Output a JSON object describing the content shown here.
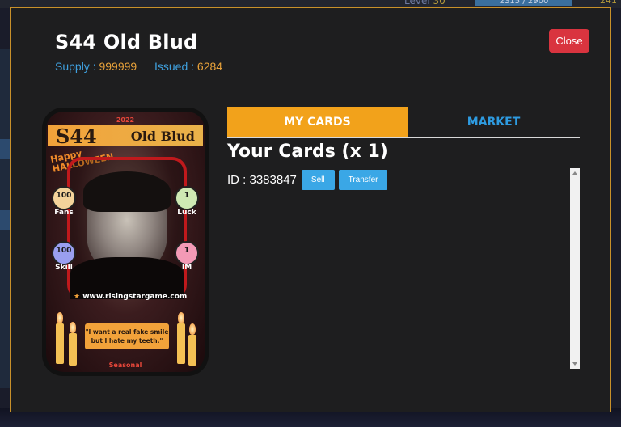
{
  "background": {
    "level_label": "Level",
    "level_value": "30",
    "xp_text": "2315 / 2900",
    "top_right_value": "241"
  },
  "modal": {
    "title": "S44 Old Blud",
    "supply_label": "Supply :",
    "supply_value": "999999",
    "issued_label": "Issued :",
    "issued_value": "6284",
    "close_label": "Close"
  },
  "card": {
    "year": "2022",
    "code": "S44",
    "name": "Old Blud",
    "halloween_line1": "Happy",
    "halloween_line2": "HALLOWEEN",
    "stats": [
      {
        "value": "100",
        "label": "Fans",
        "color": "#f4d39a"
      },
      {
        "value": "1",
        "label": "Luck",
        "color": "#cfe9b3"
      },
      {
        "value": "100",
        "label": "Skill",
        "color": "#9a9ff0"
      },
      {
        "value": "1",
        "label": "IM",
        "color": "#f39ab6"
      }
    ],
    "website": "www.risingstargame.com",
    "quote": "\"I want a real fake smile but I hate my teeth.\"",
    "rarity": "Seasonal"
  },
  "tabs": [
    {
      "label": "MY CARDS",
      "active": true
    },
    {
      "label": "MARKET",
      "active": false
    }
  ],
  "your_cards_heading": "Your Cards (x 1)",
  "owned_cards": [
    {
      "id_text": "ID : 3383847",
      "sell_label": "Sell",
      "transfer_label": "Transfer"
    }
  ]
}
